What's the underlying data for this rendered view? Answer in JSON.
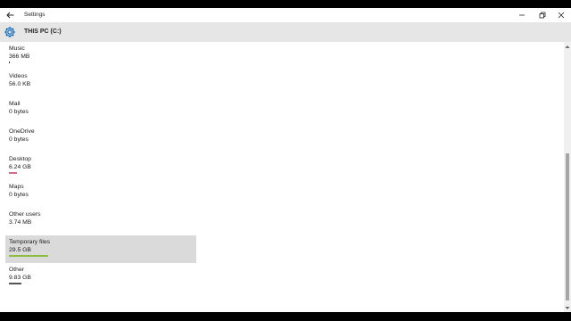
{
  "window": {
    "title": "Settings"
  },
  "header": {
    "title": "THIS PC (C:)"
  },
  "colors": {
    "header_bg": "#e6e6e6",
    "selected_bg": "#dadada",
    "scroll_thumb": "#a6a6a6"
  },
  "icons": {
    "back": "arrow-left-icon",
    "minimize": "minimize-icon",
    "maximize": "restore-icon",
    "close": "close-icon",
    "settings": "gear-icon"
  },
  "storage_items": [
    {
      "label": "Music",
      "size": "366 MB",
      "usage_fraction": 0.005,
      "bar_color": "#3a3a3a"
    },
    {
      "label": "Videos",
      "size": "56.0 KB",
      "usage_fraction": 0,
      "bar_color": "#3a3a3a"
    },
    {
      "label": "Mail",
      "size": "0 bytes",
      "usage_fraction": 0,
      "bar_color": "#3a3a3a"
    },
    {
      "label": "OneDrive",
      "size": "0 bytes",
      "usage_fraction": 0,
      "bar_color": "#3a3a3a"
    },
    {
      "label": "Desktop",
      "size": "6.24 GB",
      "usage_fraction": 0.045,
      "bar_color": "#d16b87"
    },
    {
      "label": "Maps",
      "size": "0 bytes",
      "usage_fraction": 0,
      "bar_color": "#3a3a3a"
    },
    {
      "label": "Other users",
      "size": "3.74 MB",
      "usage_fraction": 0,
      "bar_color": "#3a3a3a"
    },
    {
      "label": "Temporary files",
      "size": "29.5 GB",
      "usage_fraction": 0.215,
      "bar_color": "#8cbd3f",
      "selected": true
    },
    {
      "label": "Other",
      "size": "9.83 GB",
      "usage_fraction": 0.07,
      "bar_color": "#555555"
    }
  ]
}
